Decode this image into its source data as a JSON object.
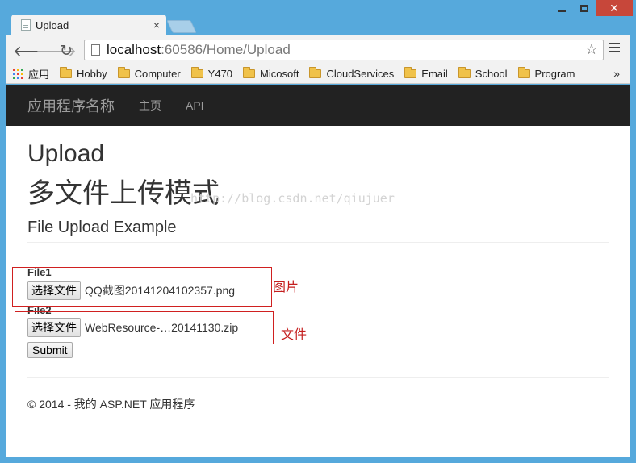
{
  "browser": {
    "tab_title": "Upload",
    "url_host": "localhost",
    "url_path": ":60586/Home/Upload",
    "bookmarks": [
      {
        "label": "应用",
        "icon": "apps-icon"
      },
      {
        "label": "Hobby",
        "icon": "folder-icon"
      },
      {
        "label": "Computer",
        "icon": "folder-icon"
      },
      {
        "label": "Y470",
        "icon": "folder-icon"
      },
      {
        "label": "Micosoft",
        "icon": "folder-icon"
      },
      {
        "label": "CloudServices",
        "icon": "folder-icon"
      },
      {
        "label": "Email",
        "icon": "folder-icon"
      },
      {
        "label": "School",
        "icon": "folder-icon"
      },
      {
        "label": "Program",
        "icon": "folder-icon"
      }
    ],
    "more": "»"
  },
  "navbar": {
    "brand": "应用程序名称",
    "links": [
      "主页",
      "API"
    ]
  },
  "page": {
    "heading": "Upload",
    "mode_title": "多文件上传模式",
    "subheading": "File Upload Example",
    "watermark": "http://blog.csdn.net/qiujuer"
  },
  "form": {
    "file1_label": "File1",
    "file1_button": "选择文件",
    "file1_value": "QQ截图20141204102357.png",
    "file2_label": "File2",
    "file2_button": "选择文件",
    "file2_value": "WebResource-…20141130.zip",
    "submit_label": "Submit"
  },
  "annotations": {
    "note1": "图片",
    "note2": "文件",
    "color": "#c41e1e"
  },
  "footer": {
    "text": "© 2014 - 我的 ASP.NET 应用程序"
  }
}
